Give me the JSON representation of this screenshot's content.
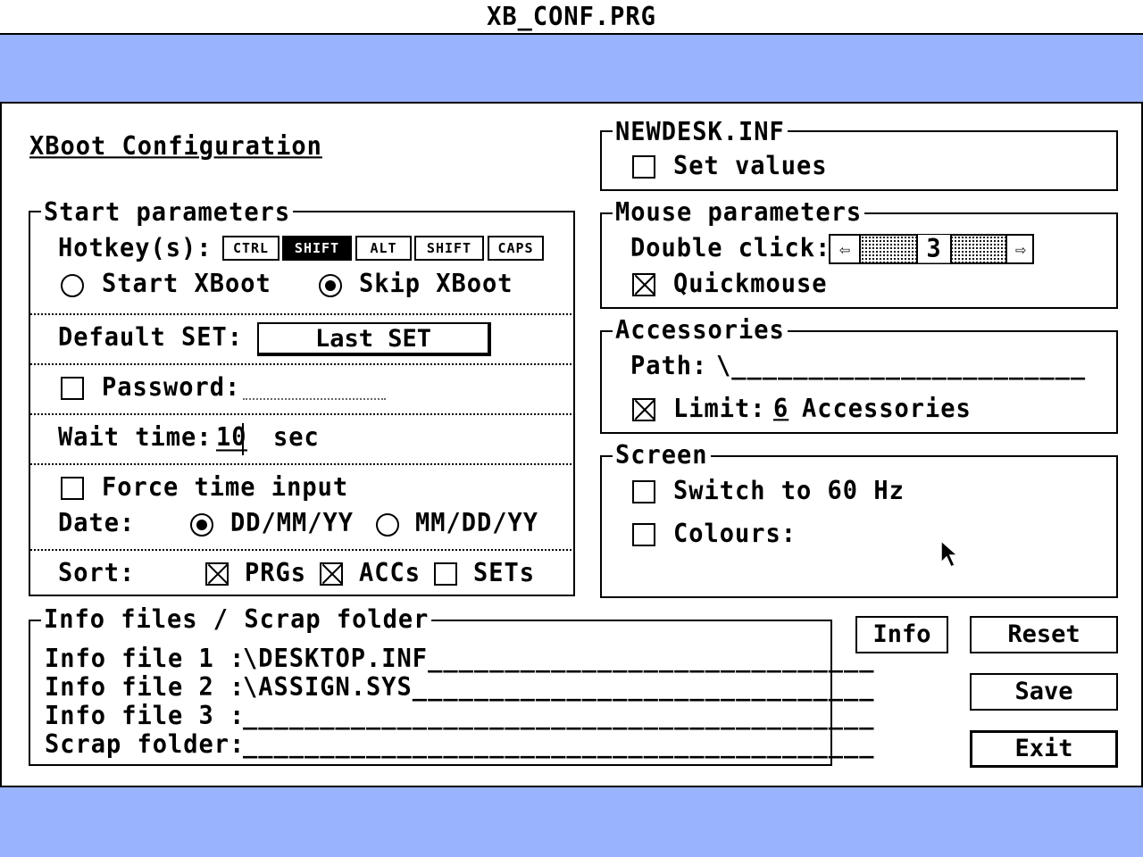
{
  "window": {
    "title": "XB_CONF.PRG"
  },
  "dialog": {
    "heading": "XBoot Configuration"
  },
  "start_params": {
    "title": "Start parameters",
    "hotkey_label": "Hotkey(s):",
    "hotkeys": [
      {
        "label": "CTRL",
        "active": false
      },
      {
        "label": "SHIFT",
        "active": true
      },
      {
        "label": "ALT",
        "active": false
      },
      {
        "label": "SHIFT",
        "active": false
      },
      {
        "label": "CAPS",
        "active": false
      }
    ],
    "radio_start": "Start XBoot",
    "radio_skip": "Skip XBoot",
    "selected": "Skip XBoot",
    "default_set_label": "Default SET:",
    "default_set_value": "Last SET",
    "password_label": "Password:",
    "password_value": "",
    "wait_label": "Wait time:",
    "wait_value": "10",
    "wait_unit": "sec",
    "force_time_label": "Force time input",
    "force_time_checked": false,
    "date_label": "Date:",
    "date_opt1": "DD/MM/YY",
    "date_opt2": "MM/DD/YY",
    "date_selected": "DD/MM/YY",
    "sort_label": "Sort:",
    "sort_prgs": "PRGs",
    "sort_accs": "ACCs",
    "sort_sets": "SETs"
  },
  "newdesk": {
    "title": "NEWDESK.INF",
    "set_values": "Set values"
  },
  "mouse": {
    "title": "Mouse parameters",
    "dbl_label": "Double click:",
    "dbl_value": "3",
    "quickmouse": "Quickmouse"
  },
  "accessories": {
    "title": "Accessories",
    "path_label": "Path:",
    "path_value": "\\_______________________",
    "limit_label": "Limit:",
    "limit_value": "6",
    "limit_suffix": "Accessories"
  },
  "screen": {
    "title": "Screen",
    "hz": "Switch to 60 Hz",
    "colours": "Colours:"
  },
  "info_files": {
    "title": "Info files / Scrap folder",
    "rows": [
      {
        "label": "Info file 1 :",
        "value": "\\DESKTOP.INF_____________________________"
      },
      {
        "label": "Info file 2 :",
        "value": "\\ASSIGN.SYS______________________________"
      },
      {
        "label": "Info file 3 :",
        "value": "_________________________________________"
      },
      {
        "label": "Scrap folder:",
        "value": "_________________________________________"
      }
    ]
  },
  "buttons": {
    "info": "Info",
    "reset": "Reset",
    "save": "Save",
    "exit": "Exit"
  },
  "colors": {
    "desktop": "#99b3ff",
    "window": "#ffffff",
    "ink": "#000000"
  }
}
